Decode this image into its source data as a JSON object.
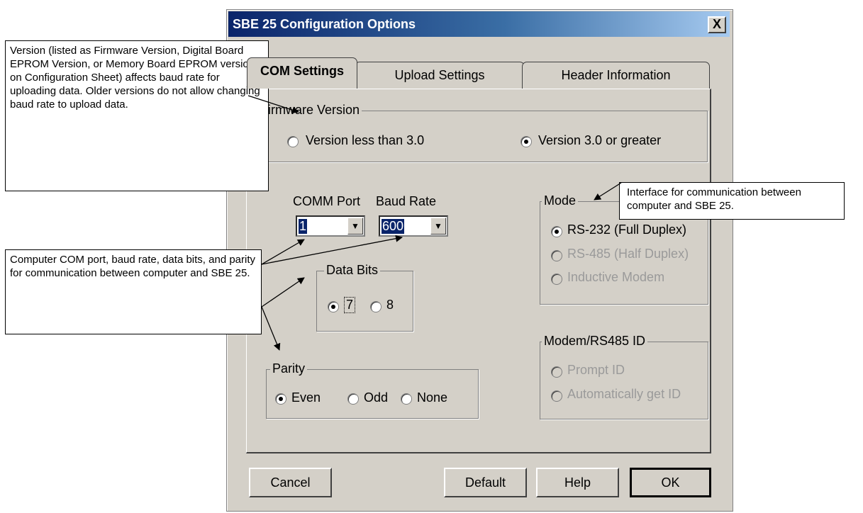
{
  "dialog": {
    "title": "SBE 25 Configuration Options",
    "close_label": "X",
    "tabs": [
      {
        "label": "COM Settings",
        "active": true
      },
      {
        "label": "Upload Settings",
        "active": false
      },
      {
        "label": "Header Information",
        "active": false
      }
    ],
    "firmware": {
      "legend": "Firmware Version",
      "options": [
        {
          "label": "Version less than 3.0",
          "selected": false
        },
        {
          "label": "Version 3.0 or greater",
          "selected": true
        }
      ]
    },
    "comm_port": {
      "label": "COMM Port",
      "value": "1"
    },
    "baud_rate": {
      "label": "Baud Rate",
      "value": "600"
    },
    "data_bits": {
      "legend": "Data Bits",
      "options": [
        {
          "label": "7",
          "selected": true
        },
        {
          "label": "8",
          "selected": false
        }
      ]
    },
    "parity": {
      "legend": "Parity",
      "options": [
        {
          "label": "Even",
          "selected": true
        },
        {
          "label": "Odd",
          "selected": false
        },
        {
          "label": "None",
          "selected": false
        }
      ]
    },
    "mode": {
      "legend": "Mode",
      "options": [
        {
          "label": "RS-232 (Full Duplex)",
          "selected": true,
          "enabled": true
        },
        {
          "label": "RS-485 (Half Duplex)",
          "selected": false,
          "enabled": false
        },
        {
          "label": "Inductive Modem",
          "selected": false,
          "enabled": false
        }
      ]
    },
    "modem_id": {
      "legend": "Modem/RS485 ID",
      "options": [
        {
          "label": "Prompt ID",
          "enabled": false
        },
        {
          "label": "Automatically get ID",
          "enabled": false
        }
      ]
    },
    "buttons": {
      "cancel": "Cancel",
      "default": "Default",
      "help": "Help",
      "ok": "OK"
    }
  },
  "callouts": {
    "version": "Version (listed as Firmware Version, Digital Board EPROM Version, or Memory Board EPROM version on Configuration Sheet) affects baud rate for uploading data. Older versions do not allow changing baud rate to upload data.",
    "interface": "Interface for communication between computer and SBE 25.",
    "com": "Computer COM port, baud rate, data bits, and parity for communication between computer and SBE 25."
  },
  "colors": {
    "dialog_bg": "#d4d0c8",
    "title_start": "#0a246a",
    "title_end": "#a6caf0",
    "selection": "#0a246a"
  }
}
